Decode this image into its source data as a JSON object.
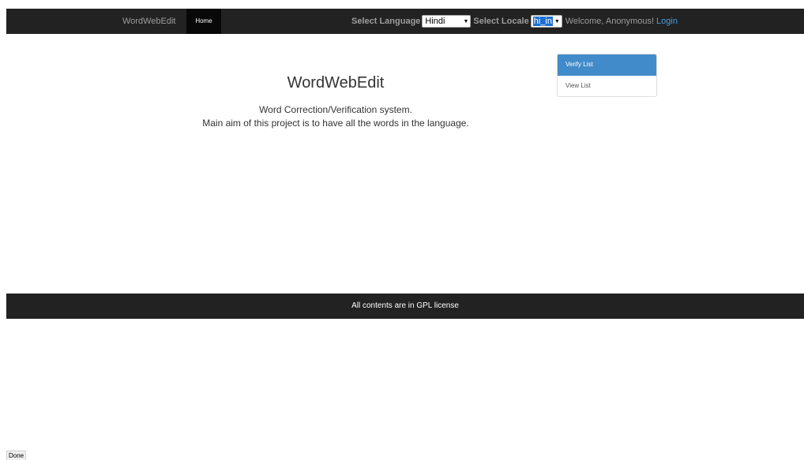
{
  "navbar": {
    "brand": "WordWebEdit",
    "home_label": "Home",
    "select_language_label": "Select Language",
    "language_value": "Hindi",
    "select_locale_label": "Select Locale",
    "locale_value": "hi_in",
    "welcome_text": "Welcome, Anonymous!",
    "login_label": "Login"
  },
  "hero": {
    "title": "WordWebEdit",
    "line1": "Word Correction/Verification system.",
    "line2": "Main aim of this project is to have all the words in the language."
  },
  "sidebar": {
    "items": [
      {
        "label": "Verify List",
        "active": true
      },
      {
        "label": "View List",
        "active": false
      }
    ]
  },
  "footer": {
    "text": "All contents are in GPL license"
  },
  "status_bar": {
    "text": "Done"
  },
  "colors": {
    "navbar_bg": "#222222",
    "accent": "#428bca",
    "link": "#4a9fe0"
  }
}
